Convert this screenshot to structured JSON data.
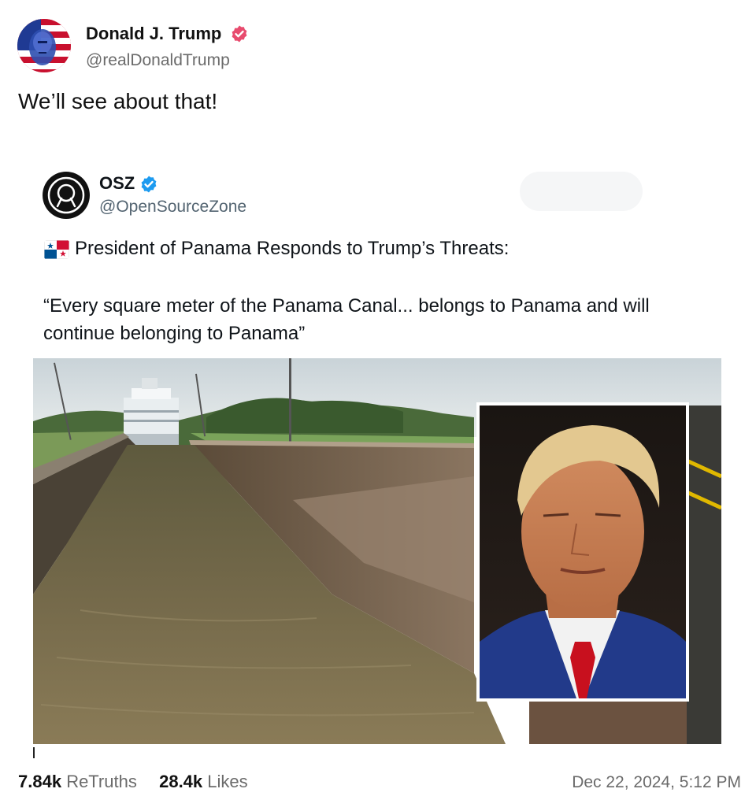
{
  "post": {
    "author_name": "Donald J. Trump",
    "author_handle": "@realDonaldTrump",
    "text": "We’ll see about that!"
  },
  "quoted": {
    "author_name": "OSZ",
    "author_handle": "@OpenSourceZone",
    "headline": "President of Panama Responds to Trump’s Threats:",
    "body": "“Every square meter of the Panama Canal... belongs to Panama and will continue belonging to Panama”",
    "flag_icon": "panama-flag-icon",
    "photo_description_icon": "canal-photo"
  },
  "stats": {
    "retruths_count": "7.84k",
    "retruths_label": "ReTruths",
    "likes_count": "28.4k",
    "likes_label": "Likes"
  },
  "timestamp": "Dec 22, 2024, 5:12 PM",
  "colors": {
    "truth_verified": "#e84b6e",
    "x_verified": "#1d9bf0",
    "muted_text": "#6b6b6b"
  }
}
